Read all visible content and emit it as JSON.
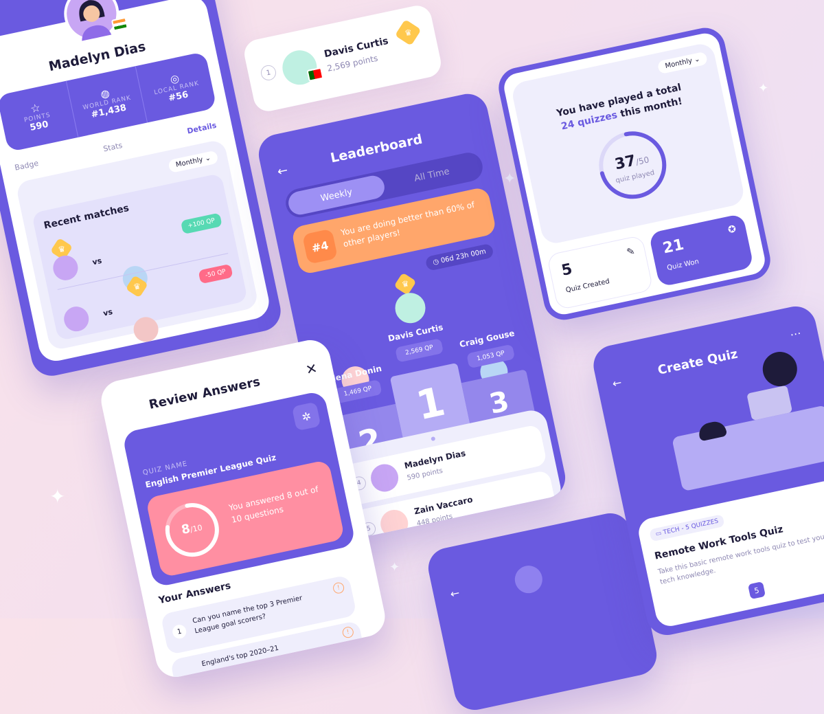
{
  "profile": {
    "name": "Madelyn Dias",
    "stats": [
      {
        "label": "POINTS",
        "value": "590",
        "icon": "star-icon"
      },
      {
        "label": "WORLD RANK",
        "value": "#1,438",
        "icon": "globe-icon"
      },
      {
        "label": "LOCAL RANK",
        "value": "#56",
        "icon": "target-icon"
      }
    ],
    "tabs": [
      "Badge",
      "Stats",
      "Details"
    ],
    "active_tab": "Details",
    "filter": "Monthly",
    "recent_title": "Recent matches",
    "matches": [
      {
        "result": "+100 QP",
        "vs": "vs"
      },
      {
        "result": "-50 QP",
        "vs": "vs"
      }
    ]
  },
  "top_card": {
    "rank": "1",
    "name": "Davis Curtis",
    "points": "2,569 points"
  },
  "leaderboard": {
    "title": "Leaderboard",
    "tabs": [
      "Weekly",
      "All Time"
    ],
    "active_tab": "Weekly",
    "banner_rank": "#4",
    "banner_text": "You are doing better than 60% of other players!",
    "timer": "06d 23h 00m",
    "podium": [
      {
        "place": "1",
        "name": "Davis Curtis",
        "qp": "2,569 QP"
      },
      {
        "place": "2",
        "name": "Alena Donin",
        "qp": "1,469 QP"
      },
      {
        "place": "3",
        "name": "Craig Gouse",
        "qp": "1,053 QP"
      }
    ],
    "list": [
      {
        "rank": "4",
        "name": "Madelyn Dias",
        "points": "590 points"
      },
      {
        "rank": "5",
        "name": "Zain Vaccaro",
        "points": "448 points"
      }
    ]
  },
  "stats_card": {
    "filter": "Monthly",
    "line1": "You have played a total",
    "line2_highlight": "24 quizzes",
    "line2_rest": "this month!",
    "played": "37",
    "total": "/50",
    "played_label": "quiz played",
    "progress": 0.74,
    "created_value": "5",
    "created_label": "Quiz Created",
    "won_value": "21",
    "won_label": "Quiz Won"
  },
  "review": {
    "title": "Review Answers",
    "quiz_name_label": "QUIZ NAME",
    "quiz_name": "English Premier League Quiz",
    "score": "8",
    "score_total": "/10",
    "score_fraction": 0.8,
    "score_text": "You answered 8 out of 10 questions",
    "your_answers": "Your Answers",
    "questions": [
      {
        "num": "1",
        "text": "Can you name the top 3 Premier League goal scorers?"
      },
      {
        "num": "2",
        "text": "England's top 2020–21"
      }
    ]
  },
  "create_quiz": {
    "title": "Create Quiz",
    "tag": "TECH - 5 QUIZZES",
    "quiz_title": "Remote Work Tools Quiz",
    "desc": "Take this basic remote work tools quiz to test your tech knowledge.",
    "page": "5"
  },
  "colors": {
    "primary": "#6a5ae0",
    "light_panel": "#efeefc",
    "orange": "#ffa66b",
    "pink": "#ff8fa2",
    "green": "#57d9b3",
    "red": "#ff6b88",
    "gold": "#ffc84d"
  }
}
